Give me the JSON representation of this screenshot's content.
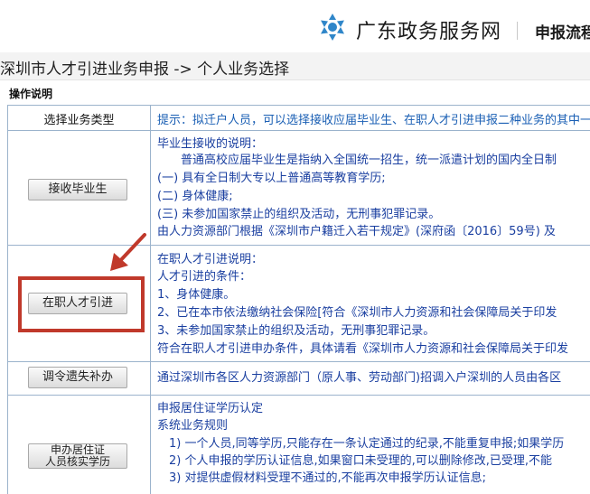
{
  "header": {
    "site_name": "广东政务服务网",
    "link": "申报流程",
    "logo_icon": "snowflake-logo-icon"
  },
  "breadcrumb": "深圳市人才引进业务申报 -> 个人业务选择",
  "section_title": "操作说明",
  "table": {
    "header_label": "选择业务类型",
    "header_tip": "提示：拟迁户人员，可以选择接收应届毕业生、在职人才引进申报二种业务的其中一种",
    "rows": [
      {
        "button": "接收毕业生",
        "lines": [
          "毕业生接收的说明：",
          "　　普通高校应届毕业生是指纳入全国统一招生，统一派遣计划的国内全日制",
          "(一) 具有全日制大专以上普通高等教育学历;",
          "(二) 身体健康;",
          "(三) 未参加国家禁止的组织及活动，无刑事犯罪记录。",
          "由人力资源部门根据《深圳市户籍迁入若干规定》(深府函〔2016〕59号) 及"
        ]
      },
      {
        "button": "在职人才引进",
        "lines": [
          "在职人才引进说明：",
          "人才引进的条件：",
          "1、身体健康。",
          "2、已在本市依法缴纳社会保险[符合《深圳市人力资源和社会保障局关于印发",
          "3、未参加国家禁止的组织及活动，无刑事犯罪记录。",
          "符合在职人才引进申办条件，具体请看《深圳市人力资源和社会保障局关于印发"
        ]
      },
      {
        "button": "调令遗失补办",
        "lines": [
          "通过深圳市各区人力资源部门（原人事、劳动部门)招调入户深圳的人员由各区"
        ]
      },
      {
        "button_line1": "申办居住证",
        "button_line2": "人员核实学历",
        "lines": [
          "申报居住证学历认定",
          "系统业务规则",
          "　1) 一个人员,同等学历,只能存在一条认定通过的纪录,不能重复申报;如果学历",
          "　2) 个人申报的学历认证信息,如果窗口未受理的,可以删除修改,已受理,不能",
          "　3) 对提供虚假材料受理不通过的,不能再次申报学历认证信息;"
        ]
      }
    ]
  },
  "colors": {
    "link_blue": "#1a3fa0",
    "tip_blue": "#1a5fb4",
    "highlight_red": "#c0392b",
    "border": "#9bb3cc"
  }
}
